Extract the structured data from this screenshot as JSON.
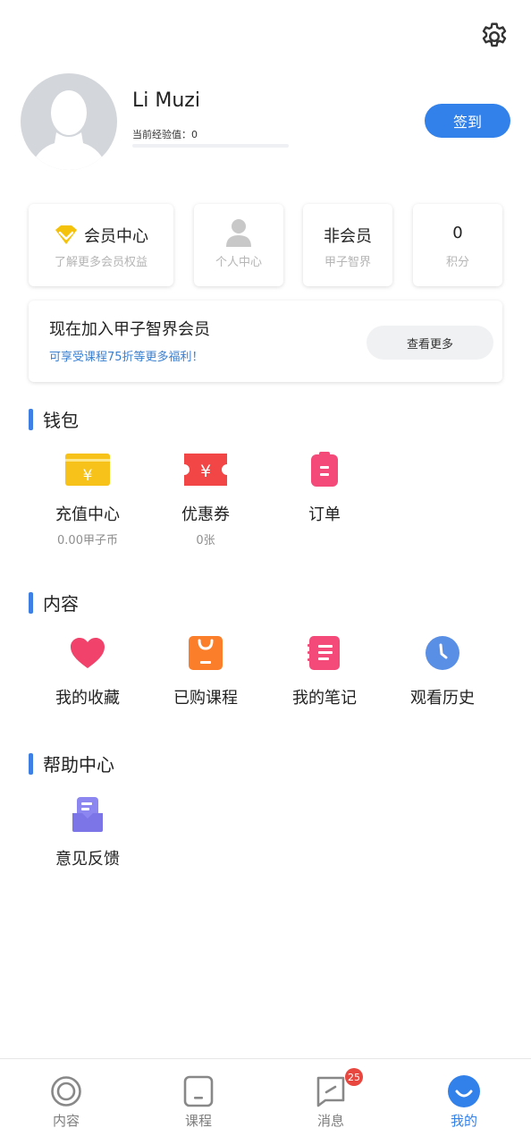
{
  "header": {
    "settings_icon": "gear-icon"
  },
  "profile": {
    "username": "Li Muzi",
    "exp_label": "当前经验值：0",
    "exp_progress": 0,
    "checkin_label": "签到",
    "avatar_icon": "user-avatar-placeholder"
  },
  "member_cards": [
    {
      "title": "会员中心",
      "subtitle": "了解更多会员权益",
      "icon": "diamond-icon"
    },
    {
      "title": "",
      "subtitle": "个人中心",
      "icon": "person-icon"
    },
    {
      "title": "非会员",
      "subtitle": "甲子智界"
    },
    {
      "title": "0",
      "subtitle": "积分"
    }
  ],
  "join_banner": {
    "title": "现在加入甲子智界会员",
    "subtitle": "可享受课程75折等更多福利！",
    "button_label": "查看更多"
  },
  "wallet": {
    "title": "钱包",
    "items": [
      {
        "label": "充值中心",
        "sub": "0.00甲子币",
        "icon": "wallet-yuan-icon"
      },
      {
        "label": "优惠券",
        "sub": "0张",
        "icon": "coupon-icon"
      },
      {
        "label": "订单",
        "sub": "",
        "icon": "order-icon"
      }
    ]
  },
  "content": {
    "title": "内容",
    "items": [
      {
        "label": "我的收藏",
        "icon": "heart-icon"
      },
      {
        "label": "已购课程",
        "icon": "purchased-course-icon"
      },
      {
        "label": "我的笔记",
        "icon": "notes-icon"
      },
      {
        "label": "观看历史",
        "icon": "clock-icon"
      }
    ]
  },
  "help": {
    "title": "帮助中心",
    "items": [
      {
        "label": "意见反馈",
        "icon": "feedback-icon"
      }
    ]
  },
  "tabbar": {
    "items": [
      {
        "label": "内容",
        "icon": "content-tab-icon",
        "active": false
      },
      {
        "label": "课程",
        "icon": "course-tab-icon",
        "active": false
      },
      {
        "label": "消息",
        "icon": "message-tab-icon",
        "active": false,
        "badge": "25"
      },
      {
        "label": "我的",
        "icon": "profile-tab-icon",
        "active": true
      }
    ]
  },
  "colors": {
    "accent": "#3280ea",
    "badge": "#e8473f"
  }
}
